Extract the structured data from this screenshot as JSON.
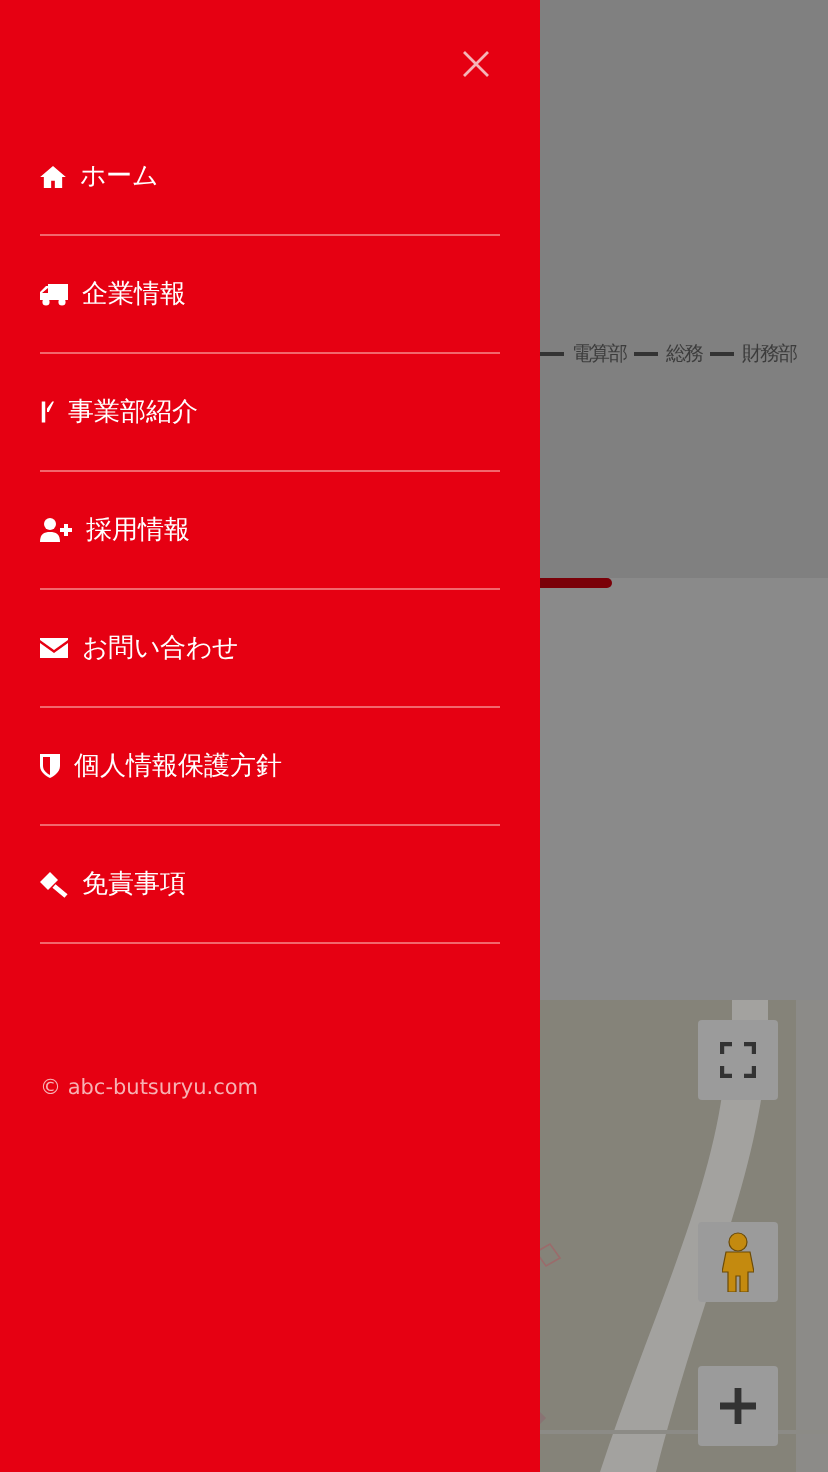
{
  "drawer": {
    "menu": [
      {
        "label": "ホーム"
      },
      {
        "label": "企業情報"
      },
      {
        "label": "事業部紹介"
      },
      {
        "label": "採用情報"
      },
      {
        "label": "お問い合わせ"
      },
      {
        "label": "個人情報保護方針"
      },
      {
        "label": "免責事項"
      }
    ],
    "footer": "© abc-butsuryu.com"
  },
  "background": {
    "org_chart": {
      "units": [
        "電算部",
        "総務",
        "財務部"
      ]
    }
  }
}
